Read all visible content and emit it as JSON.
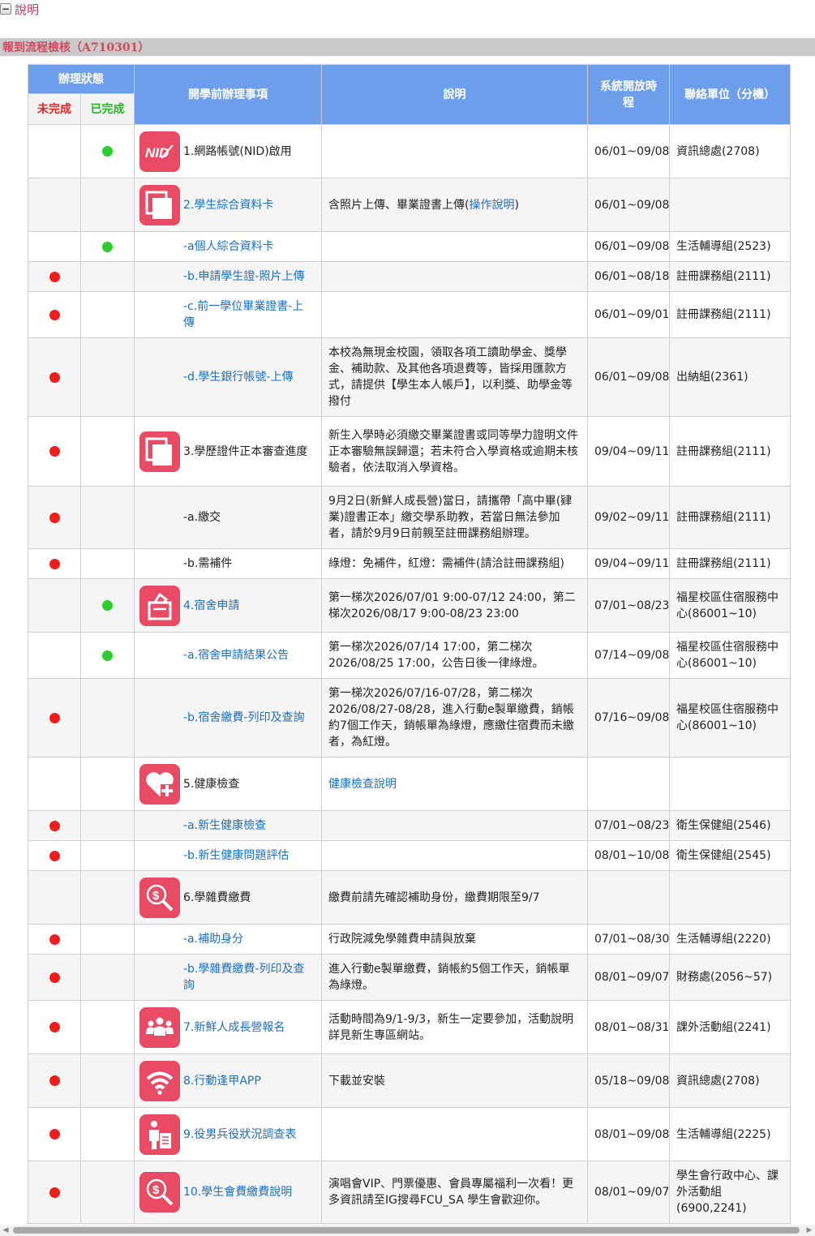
{
  "top": {
    "link_label": "說明"
  },
  "section": {
    "title": "報到流程檢核（A710301）"
  },
  "table": {
    "headers": {
      "status": "辦理狀態",
      "undone": "未完成",
      "done": "已完成",
      "item": "開學前辦理事項",
      "desc": "說明",
      "period": "系統開放時程",
      "contact": "聯絡單位（分機）"
    },
    "rows": [
      {
        "status": "done",
        "item": "1.網路帳號(NID)啟用",
        "desc": "",
        "period": "06/01~09/08",
        "contact": "資訊總處(2708)"
      },
      {
        "status": "none",
        "item": "2.學生綜合資料卡",
        "desc_pre": "含照片上傳、畢業證書上傳(",
        "desc_link": "操作說明",
        "desc_post": ")",
        "period": "06/01~09/08",
        "contact": ""
      },
      {
        "status": "done",
        "item": "-a個人綜合資料卡",
        "desc": "",
        "period": "06/01~09/08",
        "contact": "生活輔導組(2523)"
      },
      {
        "status": "undone",
        "item": "-b.申請學生證-照片上傳",
        "desc": "",
        "period": "06/01~08/18",
        "contact": "註冊課務組(2111)"
      },
      {
        "status": "undone",
        "item": "-c.前一學位畢業證書-上傳",
        "desc": "",
        "period": "06/01~09/01",
        "contact": "註冊課務組(2111)"
      },
      {
        "status": "undone",
        "item": "-d.學生銀行帳號-上傳",
        "desc": "本校為無現金校園，領取各項工讀助學金、獎學金、補助款、及其他各項退費等，皆採用匯款方式，請提供【學生本人帳戶】，以利獎、助學金等撥付",
        "period": "06/01~09/08",
        "contact": "出納組(2361)"
      },
      {
        "status": "undone",
        "item": "3.學歷證件正本審查進度",
        "desc": "新生入學時必須繳交畢業證書或同等學力證明文件正本審驗無誤歸還；若未符合入學資格或逾期未核驗者，依法取消入學資格。",
        "period": "09/04~09/11",
        "contact": "註冊課務組(2111)"
      },
      {
        "status": "undone",
        "item": "-a.繳交",
        "desc": "9月2日(新鮮人成長營)當日，請攜帶「高中畢(肄業)證書正本」繳交學系助教，若當日無法參加者，請於9月9日前親至註冊課務組辦理。",
        "period": "09/02~09/11",
        "contact": "註冊課務組(2111)"
      },
      {
        "status": "undone",
        "item": "-b.需補件",
        "desc": "綠燈：免補件，紅燈：需補件(請洽註冊課務組)",
        "period": "09/04~09/11",
        "contact": "註冊課務組(2111)"
      },
      {
        "status": "done",
        "item": "4.宿舍申請",
        "desc": "第一梯次2026/07/01 9:00-07/12 24:00，第二梯次2026/08/17 9:00-08/23 23:00",
        "period": "07/01~08/23",
        "contact": "福星校區住宿服務中心(86001~10)"
      },
      {
        "status": "done",
        "item": "-a.宿舍申請結果公告",
        "desc": "第一梯次2026/07/14 17:00，第二梯次2026/08/25 17:00，公告日後一律綠燈。",
        "period": "07/14~09/08",
        "contact": "福星校區住宿服務中心(86001~10)"
      },
      {
        "status": "undone",
        "item": "-b.宿舍繳費-列印及查詢",
        "desc": "第一梯次2026/07/16-07/28，第二梯次2026/08/27-08/28，進入行動e製單繳費，銷帳約7個工作天，銷帳單為綠燈，應繳住宿費而未繳者，為紅燈。",
        "period": "07/16~09/08",
        "contact": "福星校區住宿服務中心(86001~10)"
      },
      {
        "status": "none",
        "item": "5.健康檢查",
        "desc_link": "健康檢查說明",
        "period": "",
        "contact": ""
      },
      {
        "status": "undone",
        "item": "-a.新生健康檢查",
        "desc": "",
        "period": "07/01~08/23",
        "contact": "衛生保健組(2546)"
      },
      {
        "status": "undone",
        "item": "-b.新生健康問題評估",
        "desc": "",
        "period": "08/01~10/08",
        "contact": "衛生保健組(2545)"
      },
      {
        "status": "none",
        "item": "6.學雜費繳費",
        "desc": "繳費前請先確認補助身份，繳費期限至9/7",
        "period": "",
        "contact": ""
      },
      {
        "status": "undone",
        "item": "-a.補助身分",
        "desc": "行政院減免學雜費申請與放棄",
        "period": "07/01~08/30",
        "contact": "生活輔導組(2220)"
      },
      {
        "status": "undone",
        "item": "-b.學雜費繳費-列印及查詢",
        "desc": "進入行動e製單繳費，銷帳約5個工作天，銷帳單為綠燈。",
        "period": "08/01~09/07",
        "contact": "財務處(2056~57)"
      },
      {
        "status": "undone",
        "item": "7.新鮮人成長營報名",
        "desc": "活動時間為9/1-9/3，新生一定要參加，活動說明詳見新生專區網站。",
        "period": "08/01~08/31",
        "contact": "課外活動組(2241)"
      },
      {
        "status": "undone",
        "item": "8.行動逢甲APP",
        "desc": "下載並安裝",
        "period": "05/18~09/08",
        "contact": "資訊總處(2708)"
      },
      {
        "status": "undone",
        "item": "9.役男兵役狀況調查表",
        "desc": "",
        "period": "08/01~09/08",
        "contact": "生活輔導組(2225)"
      },
      {
        "status": "undone",
        "item": "10.學生會費繳費說明",
        "desc": "演唱會VIP、門票優惠、會員專屬福利一次看！更多資訊請至IG搜尋FCU_SA 學生會歡迎你。",
        "period": "08/01~09/07",
        "contact": "學生會行政中心、課外活動組(6900,2241)"
      }
    ]
  },
  "icons": {
    "nid": "nid-icon",
    "card": "document-card-icon",
    "dorm": "ballot-box-icon",
    "health": "heart-plus-icon",
    "fee": "money-search-icon",
    "camp": "people-group-icon",
    "wifi": "wifi-icon",
    "military": "person-document-icon"
  },
  "colors": {
    "header_bg": "#6d9eeb",
    "icon_bg": "#e94a64",
    "undone": "#ee1c1c",
    "done": "#2ecc2e",
    "link": "#1a6fc4",
    "section_text": "#d2485c"
  }
}
